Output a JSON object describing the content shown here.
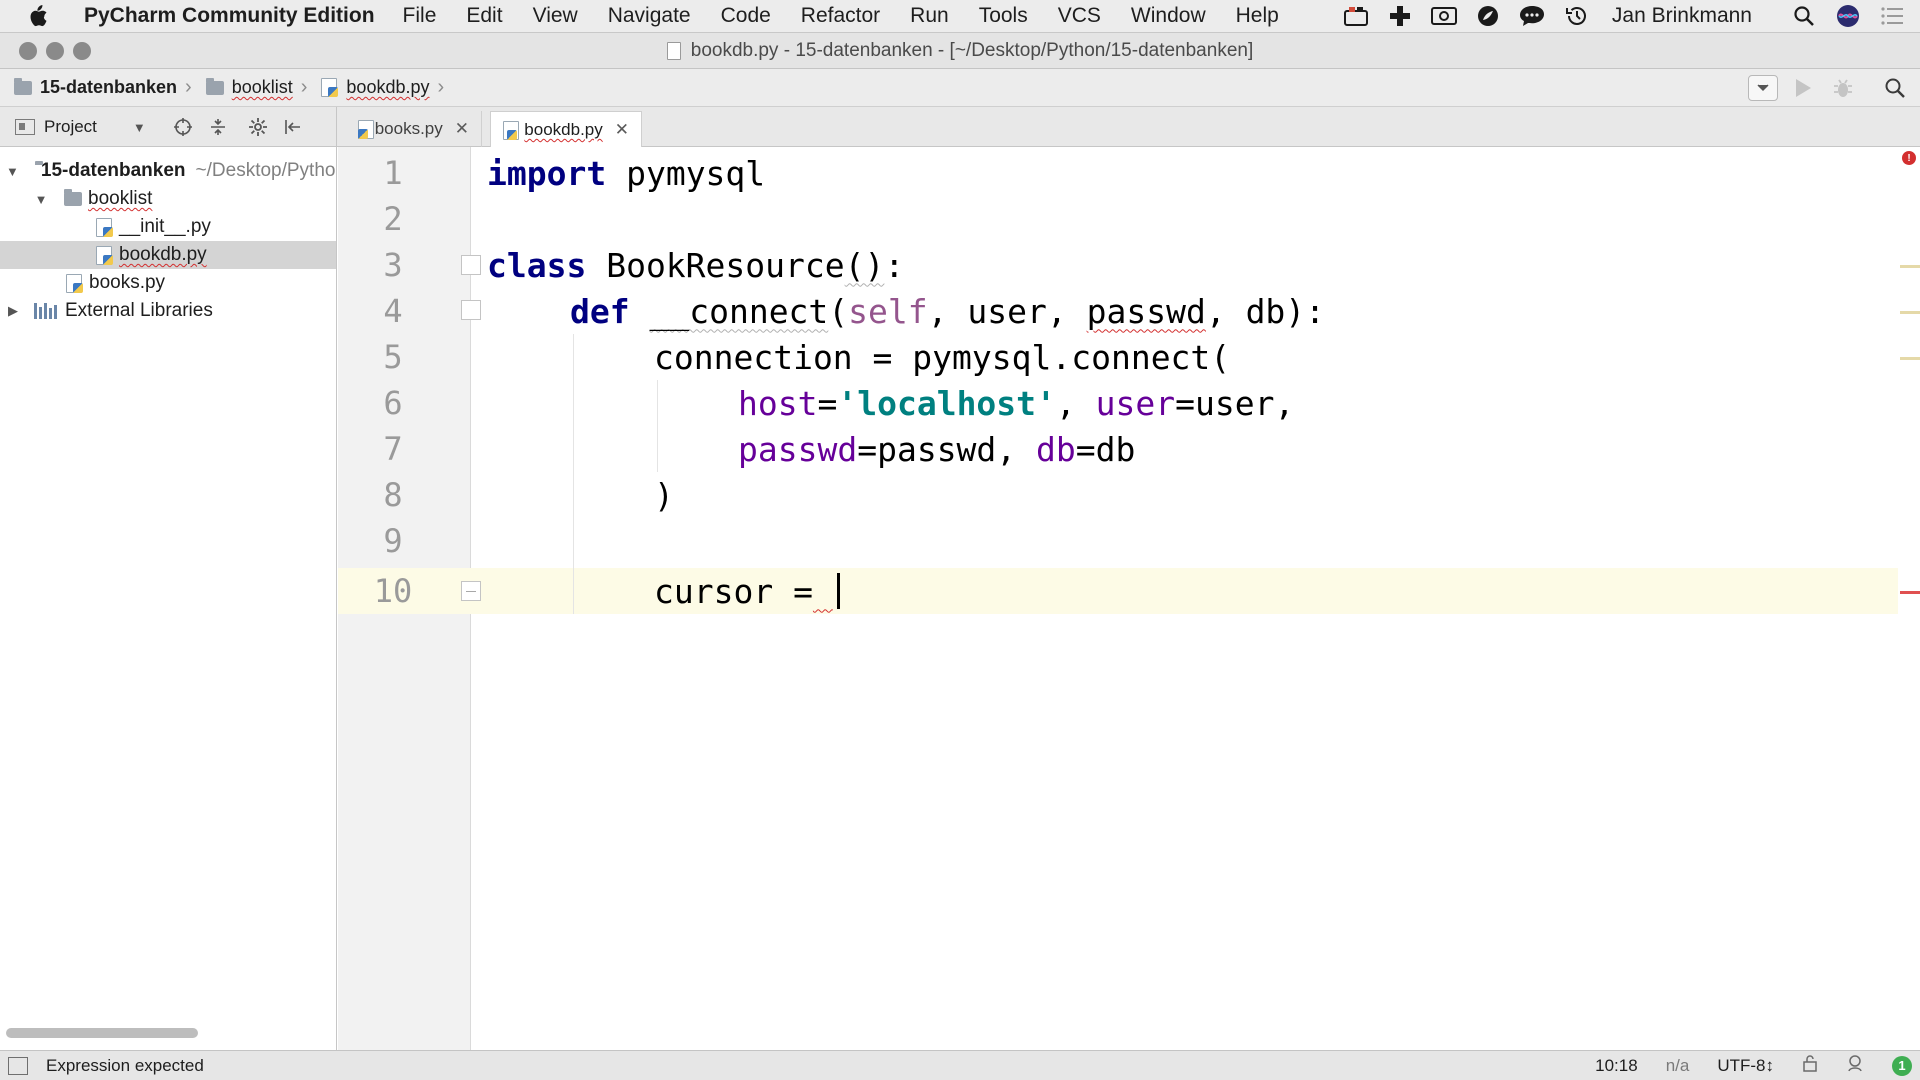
{
  "menubar": {
    "app_name": "PyCharm Community Edition",
    "items": [
      "File",
      "Edit",
      "View",
      "Navigate",
      "Code",
      "Refactor",
      "Run",
      "Tools",
      "VCS",
      "Window",
      "Help"
    ],
    "user": "Jan Brinkmann",
    "tray_icons": [
      "app-icon",
      "plus-icon",
      "camera-icon",
      "leaf-icon",
      "chat-icon",
      "time-machine-icon",
      "spotlight-search-icon",
      "siri-icon",
      "notifications-list-icon"
    ]
  },
  "window": {
    "title": "bookdb.py - 15-datenbanken - [~/Desktop/Python/15-datenbanken]"
  },
  "breadcrumbs": [
    {
      "label": "15-datenbanken",
      "icon": "folder-icon"
    },
    {
      "label": "booklist",
      "icon": "folder-icon"
    },
    {
      "label": "bookdb.py",
      "icon": "python-file-icon"
    }
  ],
  "project_panel": {
    "header": "Project",
    "tree": [
      {
        "label": "15-datenbanken",
        "hint": "~/Desktop/Python/15-datenbanken",
        "icon": "folder-icon",
        "expanded": true
      },
      {
        "label": "booklist",
        "icon": "folder-icon",
        "expanded": true
      },
      {
        "label": "__init__.py",
        "icon": "python-file-icon"
      },
      {
        "label": "bookdb.py",
        "icon": "python-file-icon",
        "selected": true
      },
      {
        "label": "books.py",
        "icon": "python-file-icon"
      },
      {
        "label": "External Libraries",
        "icon": "libraries-icon",
        "expanded": false
      }
    ]
  },
  "tabs": [
    {
      "label": "books.py",
      "active": false
    },
    {
      "label": "bookdb.py",
      "active": true
    }
  ],
  "editor": {
    "line_numbers": [
      "1",
      "2",
      "3",
      "4",
      "5",
      "6",
      "7",
      "8",
      "9",
      "10"
    ],
    "tokens": {
      "l1_kw": "import",
      "l1_rest": " pymysql",
      "l3_kw": "class",
      "l3_name": " BookResource",
      "l3_parens": "()",
      "l3_colon": ":",
      "l4_kw": "def",
      "l4_sp": " ",
      "l4_name": "__connect",
      "l4_open": "(",
      "l4_self": "self",
      "l4_mid": ", user, ",
      "l4_passwd": "passwd",
      "l4_end": ", db):",
      "l5": "connection = pymysql.connect(",
      "l6_host": "host",
      "l6_eq": "=",
      "l6_str": "'localhost'",
      "l6_comma": ", ",
      "l6_user": "user",
      "l6_rest": "=user,",
      "l7_passwd": "passwd",
      "l7_mid": "=passwd, ",
      "l7_db": "db",
      "l7_rest": "=db",
      "l8": ")",
      "l10": "cursor =",
      "l10_err": " "
    }
  },
  "statusbar": {
    "message": "Expression expected",
    "position": "10:18",
    "na": "n/a",
    "encoding": "UTF-8↕",
    "badge": "1"
  },
  "colors": {
    "keyword": "#000080",
    "string": "#008080",
    "parameter": "#660099",
    "self": "#94558d",
    "error": "#d32f2f",
    "current_line": "#fdfbe6"
  }
}
